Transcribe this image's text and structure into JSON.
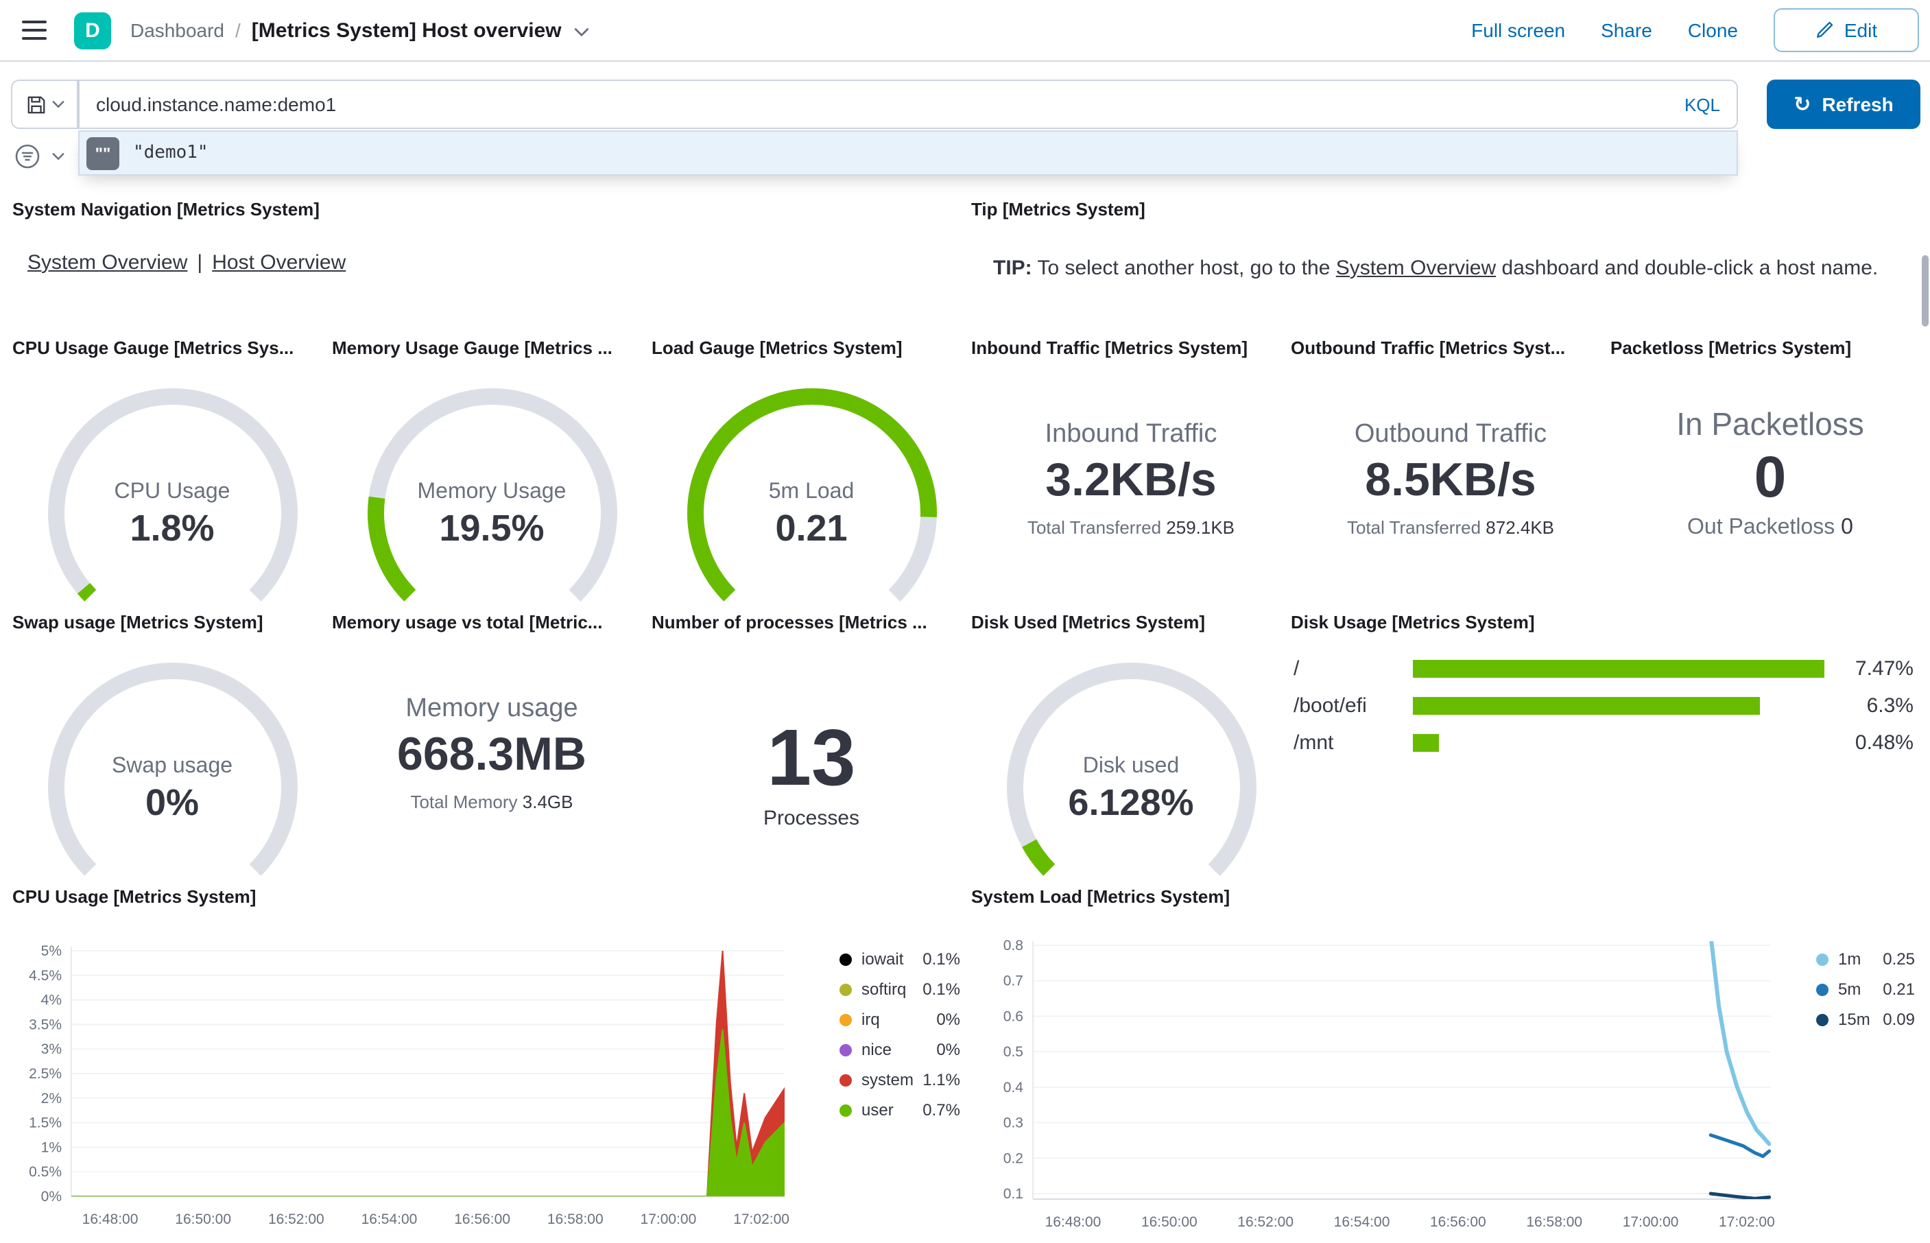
{
  "header": {
    "space_initial": "D",
    "breadcrumb_root": "Dashboard",
    "breadcrumb_sep": "/",
    "title": "[Metrics System] Host overview",
    "actions": {
      "full_screen": "Full screen",
      "share": "Share",
      "clone": "Clone",
      "edit": "Edit"
    }
  },
  "query_bar": {
    "query": "cloud.instance.name:demo1",
    "language_label": "KQL",
    "refresh_label": "Refresh",
    "suggestion_value": "\"demo1\"",
    "suggestion_icon": "\"\""
  },
  "filter_bar": {
    "add_symbol": "+"
  },
  "colors": {
    "gauge_green": "#68BC00",
    "gauge_track": "#DCE0E6",
    "brand_blue": "#006BB4",
    "space_teal": "#00BFB3"
  },
  "panels": {
    "system_navigation": {
      "title": "System Navigation [Metrics System]",
      "link1": "System Overview",
      "separator": "|",
      "link2": "Host Overview"
    },
    "tip": {
      "title": "Tip [Metrics System]",
      "bold_prefix": "TIP:",
      "before_link": " To select another host, go to the ",
      "link": "System Overview",
      "after_link": " dashboard and double-click a host name."
    },
    "cpu_gauge": {
      "title": "CPU Usage Gauge [Metrics Sys...",
      "label": "CPU Usage",
      "value": "1.8%",
      "fraction": 0.018
    },
    "memory_gauge": {
      "title": "Memory Usage Gauge [Metrics ...",
      "label": "Memory Usage",
      "value": "19.5%",
      "fraction": 0.195
    },
    "load_gauge": {
      "title": "Load Gauge [Metrics System]",
      "label": "5m Load",
      "value": "0.21",
      "fraction": 0.84
    },
    "inbound_traffic": {
      "title": "Inbound Traffic [Metrics System]",
      "label": "Inbound Traffic",
      "value": "3.2KB/s",
      "sub_label": "Total Transferred",
      "sub_value": "259.1KB"
    },
    "outbound_traffic": {
      "title": "Outbound Traffic [Metrics Syst...",
      "label": "Outbound Traffic",
      "value": "8.5KB/s",
      "sub_label": "Total Transferred",
      "sub_value": "872.4KB"
    },
    "packetloss": {
      "title": "Packetloss [Metrics System]",
      "in_label": "In Packetloss",
      "in_value": "0",
      "out_label": "Out Packetloss",
      "out_value": "0"
    },
    "swap_gauge": {
      "title": "Swap usage [Metrics System]",
      "label": "Swap usage",
      "value": "0%",
      "fraction": 0
    },
    "memory_vs_total": {
      "title": "Memory usage vs total [Metric...",
      "label": "Memory usage",
      "value": "668.3MB",
      "sub_label": "Total Memory",
      "sub_value": "3.4GB"
    },
    "processes": {
      "title": "Number of processes [Metrics ...",
      "value": "13",
      "label": "Processes"
    },
    "disk_used_gauge": {
      "title": "Disk Used [Metrics System]",
      "label": "Disk used",
      "value": "6.128%",
      "fraction": 0.061
    },
    "disk_usage": {
      "title": "Disk Usage [Metrics System]",
      "rows": [
        {
          "label": "/",
          "value": 7.47,
          "display": "7.47%"
        },
        {
          "label": "/boot/efi",
          "value": 6.3,
          "display": "6.3%"
        },
        {
          "label": "/mnt",
          "value": 0.48,
          "display": "0.48%"
        }
      ]
    },
    "cpu_chart_title": "CPU Usage [Metrics System]",
    "load_chart_title": "System Load [Metrics System]"
  },
  "chart_data": [
    {
      "type": "area",
      "stacked": true,
      "title": "CPU Usage [Metrics System]",
      "x_range": [
        "16:47:10",
        "17:02:30"
      ],
      "x_ticks": [
        "16:48:00",
        "16:50:00",
        "16:52:00",
        "16:54:00",
        "16:56:00",
        "16:58:00",
        "17:00:00",
        "17:02:00"
      ],
      "y_ticks": [
        5,
        4.5,
        4,
        3.5,
        3,
        2.5,
        2,
        1.5,
        1,
        0.5,
        0
      ],
      "y_tick_labels": [
        "5%",
        "4.5%",
        "4%",
        "3.5%",
        "3%",
        "2.5%",
        "2%",
        "1.5%",
        "1%",
        "0.5%",
        "0%"
      ],
      "ylim": [
        0,
        5
      ],
      "legend_position": "right",
      "legend": [
        {
          "name": "iowait",
          "value": "0.1%",
          "color": "#000000"
        },
        {
          "name": "softirq",
          "value": "0.1%",
          "color": "#AFB42B"
        },
        {
          "name": "irq",
          "value": "0%",
          "color": "#F5A623"
        },
        {
          "name": "nice",
          "value": "0%",
          "color": "#9B59D0"
        },
        {
          "name": "system",
          "value": "1.1%",
          "color": "#D23A2E"
        },
        {
          "name": "user",
          "value": "0.7%",
          "color": "#68BC00"
        }
      ],
      "series": [
        {
          "name": "user",
          "color": "#68BC00",
          "points": [
            [
              "16:47:10",
              0
            ],
            [
              "17:00:50",
              0
            ],
            [
              "17:01:02",
              2.4
            ],
            [
              "17:01:10",
              3.4
            ],
            [
              "17:01:20",
              1.6
            ],
            [
              "17:01:28",
              0.7
            ],
            [
              "17:01:38",
              1.5
            ],
            [
              "17:01:48",
              0.6
            ],
            [
              "17:02:05",
              1.1
            ],
            [
              "17:02:30",
              1.5
            ]
          ]
        },
        {
          "name": "system",
          "color": "#D23A2E",
          "points": [
            [
              "16:47:10",
              0
            ],
            [
              "17:00:50",
              0
            ],
            [
              "17:01:02",
              1.1
            ],
            [
              "17:01:10",
              1.6
            ],
            [
              "17:01:20",
              0.7
            ],
            [
              "17:01:28",
              0.3
            ],
            [
              "17:01:38",
              0.6
            ],
            [
              "17:01:48",
              0.3
            ],
            [
              "17:02:05",
              0.5
            ],
            [
              "17:02:30",
              0.7
            ]
          ]
        }
      ]
    },
    {
      "type": "line",
      "title": "System Load [Metrics System]",
      "x_range": [
        "16:47:10",
        "17:02:30"
      ],
      "x_ticks": [
        "16:48:00",
        "16:50:00",
        "16:52:00",
        "16:54:00",
        "16:56:00",
        "16:58:00",
        "17:00:00",
        "17:02:00"
      ],
      "y_ticks": [
        0.8,
        0.7,
        0.6,
        0.5,
        0.4,
        0.3,
        0.2,
        0.1
      ],
      "y_tick_labels": [
        "0.8",
        "0.7",
        "0.6",
        "0.5",
        "0.4",
        "0.3",
        "0.2",
        "0.1"
      ],
      "ylim": [
        0.07,
        0.8
      ],
      "legend_position": "right",
      "legend": [
        {
          "name": "1m",
          "value": "0.25",
          "color": "#7FC6E6"
        },
        {
          "name": "5m",
          "value": "0.21",
          "color": "#2077B4"
        },
        {
          "name": "15m",
          "value": "0.09",
          "color": "#15476E"
        }
      ],
      "series": [
        {
          "name": "1m",
          "color": "#7FC6E6",
          "width": 3,
          "points": [
            [
              "17:01:15",
              0.83
            ],
            [
              "17:01:25",
              0.63
            ],
            [
              "17:01:35",
              0.5
            ],
            [
              "17:01:48",
              0.4
            ],
            [
              "17:02:00",
              0.33
            ],
            [
              "17:02:12",
              0.28
            ],
            [
              "17:02:20",
              0.26
            ],
            [
              "17:02:28",
              0.24
            ]
          ]
        },
        {
          "name": "5m",
          "color": "#2077B4",
          "width": 2.5,
          "points": [
            [
              "17:01:15",
              0.265
            ],
            [
              "17:01:35",
              0.25
            ],
            [
              "17:01:55",
              0.235
            ],
            [
              "17:02:10",
              0.215
            ],
            [
              "17:02:20",
              0.205
            ],
            [
              "17:02:28",
              0.22
            ]
          ]
        },
        {
          "name": "15m",
          "color": "#15476E",
          "width": 2.5,
          "points": [
            [
              "17:01:15",
              0.1
            ],
            [
              "17:01:45",
              0.092
            ],
            [
              "17:02:10",
              0.086
            ],
            [
              "17:02:28",
              0.09
            ]
          ]
        }
      ]
    }
  ]
}
